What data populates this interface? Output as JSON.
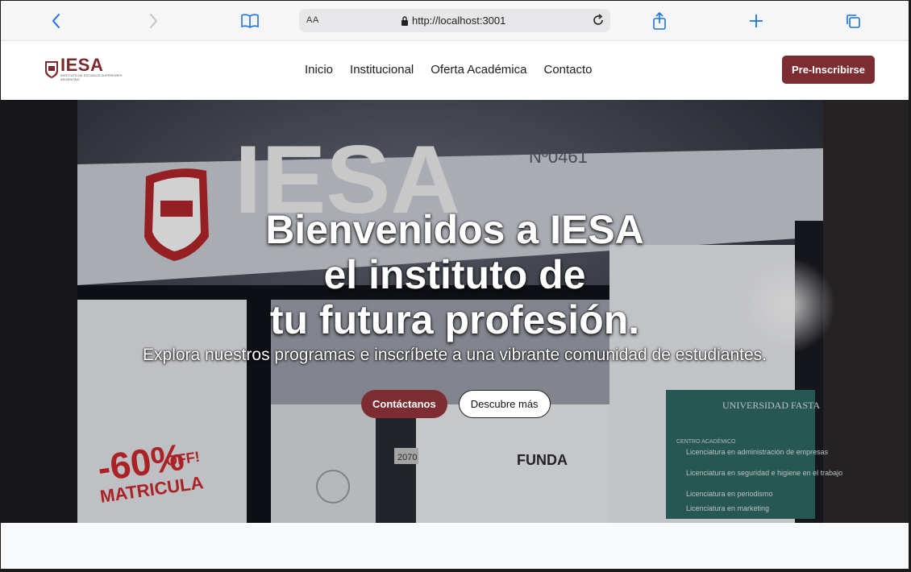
{
  "browser": {
    "reader_label": "AA",
    "url": "http://localhost:3001",
    "icons": [
      "back-icon",
      "forward-icon",
      "book-icon",
      "lock-icon",
      "reload-icon",
      "share-icon",
      "plus-icon",
      "tabs-icon"
    ]
  },
  "site": {
    "logo_name": "IESA",
    "logo_sub": "INSTITUTO DE ESTUDIOS SUPERIORES ARGENTINO",
    "nav": [
      "Inicio",
      "Institucional",
      "Oferta Académica",
      "Contacto"
    ],
    "cta": "Pre-Inscribirse",
    "brand_color": "#7d2c31"
  },
  "hero": {
    "title_line1": "Bienvenidos a IESA",
    "title_line2": "el instituto de",
    "title_line3": "tu futura profesión.",
    "subtitle": "Explora nuestros programas e inscríbete a una vibrante comunidad de estudiantes.",
    "primary_button": "Contáctanos",
    "secondary_button": "Descubre más",
    "photo": {
      "sign_letters": "IESA",
      "sign_number": "Nº0461",
      "promo_big": "-60%",
      "promo_off": "OFF!",
      "promo_label": "MATRICULA",
      "door_number": "2070",
      "fasta_brand": "UNIVERSIDAD FASTA",
      "fasta_heading": "CENTRO ACADÉMICO",
      "fasta_items": [
        "Licenciatura en administración de empresas",
        "Licenciatura en seguridad e higiene en el trabajo",
        "Licenciatura en periodismo",
        "Licenciatura en marketing"
      ],
      "funda_text": "FUNDA"
    }
  }
}
